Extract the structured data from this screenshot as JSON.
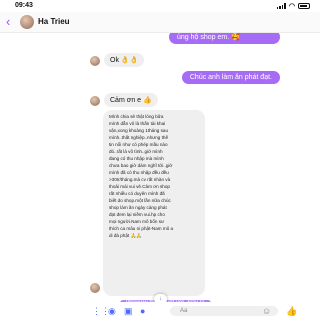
{
  "status": {
    "time": "09:43"
  },
  "header": {
    "contact_name": "Ha Trieu",
    "back_icon": "chevron-left-icon"
  },
  "messages": [
    {
      "dir": "out",
      "text": "ủng hộ shop em. 🥰"
    },
    {
      "dir": "in",
      "text": "Ok 👌👌"
    },
    {
      "dir": "out",
      "text": "Chúc anh làm ăn phát đạt."
    },
    {
      "dir": "in",
      "text": "Cảm ơn e 👍"
    }
  ],
  "long_message": {
    "lines": [
      "Mình chia sẻ thật lòng bữa",
      "mình dẫn vô là thấn tài khai",
      "vận,xong khoảng 1tháng sau",
      "mình..thất nghiệp..nhưng thế",
      "tin nổi như có phép mầu nào",
      "đó..rất là vô tình..giờ mình",
      "đang có thu nhập mà mình",
      "chưa bao giờ dám nghĩ tới..giờ",
      "mình đã có thu nhập đều đều",
      ">30tr/tháng.mà cv rất nhàn và",
      "thoải mái vui vẻ.Cảm ơn shop",
      "rất nhiều có duyên mình đã",
      "biết do shop.một lần nữa chúc",
      "shop làm ăn ngày càng phát",
      "đạt đem lại niềm vui.hp cho",
      "mọi người.Nam mô bổn sư",
      "thích ca mâu ni phật-Nam mô a",
      "di đà phật 🙏🙏"
    ]
  },
  "composer": {
    "preview": "Wowww thật tuyệt vời. Đây là",
    "placeholder": "Aa"
  },
  "colors": {
    "accent": "#a66cf5",
    "icon_blue": "#4a6cf7"
  }
}
